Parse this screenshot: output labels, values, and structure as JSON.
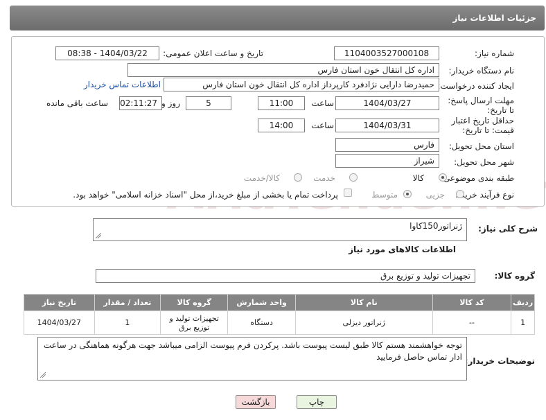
{
  "header": {
    "title": "جزئیات اطلاعات نیاز"
  },
  "form": {
    "need_number_label": "شماره نیاز:",
    "need_number": "1104003527000108",
    "announce_label": "تاریخ و ساعت اعلان عمومی:",
    "announce_value": "1404/03/22 - 08:38",
    "buyer_org_label": "نام دستگاه خریدار:",
    "buyer_org": "اداره کل انتقال خون استان فارس",
    "creator_label": "ایجاد کننده درخواست:",
    "creator": "حمیدرضا دارایی نژادفرد کارپرداز اداره کل انتقال خون استان فارس",
    "contact_link": "اطلاعات تماس خریدار",
    "reply_deadline_label": "مهلت ارسال پاسخ: تا تاریخ:",
    "reply_date": "1404/03/27",
    "time_label": "ساعت",
    "reply_time": "11:00",
    "days_value": "5",
    "days_label": "روز و",
    "remaining_value": "02:11:27",
    "remaining_label": "ساعت باقی مانده",
    "price_deadline_label": "حداقل تاریخ اعتبار قیمت: تا تاریخ:",
    "price_date": "1404/03/31",
    "price_time_label": "ساعت",
    "price_time": "14:00",
    "province_label": "استان محل تحویل:",
    "province": "فارس",
    "city_label": "شهر محل تحویل:",
    "city": "شیراز",
    "category_label": "طبقه بندی موضوعی:",
    "category_options": [
      "کالا",
      "خدمت",
      "کالا/خدمت"
    ],
    "process_label": "نوع فرآیند خرید :",
    "process_options": [
      "جزیی",
      "متوسط"
    ],
    "payment_note": "پرداخت تمام یا بخشی از مبلغ خرید،از محل \"اسناد خزانه اسلامی\" خواهد بود."
  },
  "description": {
    "label": "شرح کلی نیاز:",
    "value": "ژنراتور150کاوا"
  },
  "goods_section": {
    "title": "اطلاعات کالاهای مورد نیاز",
    "group_label": "گروه کالا:",
    "group_value": "تجهیزات تولید و توزیع برق"
  },
  "table": {
    "headers": [
      "ردیف",
      "کد کالا",
      "نام کالا",
      "واحد شمارش",
      "گروه کالا",
      "تعداد / مقدار",
      "تاریخ نیاز"
    ],
    "rows": [
      [
        "1",
        "--",
        "ژنراتور دیزلی",
        "دستگاه",
        "تجهیزات تولید و توزیع برق",
        "1",
        "1404/03/27"
      ]
    ]
  },
  "buyer_notes": {
    "label": "توضیحات خریدار:",
    "value": "توجه خواهشمند هستم کالا طبق لیست پیوست باشد. پرکردن فرم پیوست الزامی میباشد جهت هرگونه هماهنگی در ساعت ادار تماس حاصل فرمایید"
  },
  "buttons": {
    "print": "چاپ",
    "back": "بازگشت"
  },
  "watermark": "AriaTender.net",
  "colors": {
    "header_bg": "#7a7a7a",
    "link": "#1d4fa3",
    "back_button_bg": "#f7d9d9",
    "print_button_bg": "#e9f5e1"
  }
}
